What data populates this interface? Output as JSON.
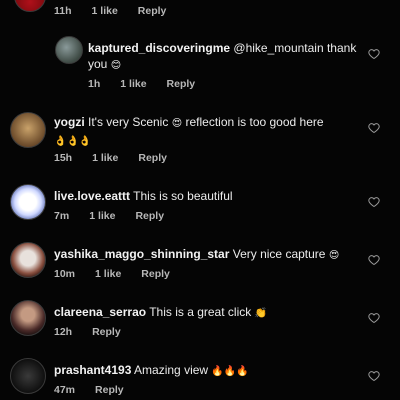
{
  "colors": {
    "background": "#050505",
    "text": "#f2f2f2",
    "meta": "#b8b8b8"
  },
  "top_meta": {
    "time": "11h",
    "likes": "1 like",
    "reply": "Reply"
  },
  "comments": [
    {
      "username": "kaptured_discoveringme",
      "text": "@hike_mountain thank you",
      "emoji": "😊",
      "time": "1h",
      "likes": "1 like",
      "reply": "Reply"
    },
    {
      "username": "yogzi",
      "text": "It's very Scenic",
      "emoji_mid": "😍",
      "text2": "reflection is too good here",
      "emoji_line2": "👌👌👌",
      "time": "15h",
      "likes": "1 like",
      "reply": "Reply"
    },
    {
      "username": "live.love.eattt",
      "text": "This is so beautiful",
      "time": "7m",
      "likes": "1 like",
      "reply": "Reply"
    },
    {
      "username": "yashika_maggo_shinning_star",
      "text": "Very nice capture",
      "emoji": "😍",
      "time": "10m",
      "likes": "1 like",
      "reply": "Reply"
    },
    {
      "username": "clareena_serrao",
      "text": "This is a great click",
      "emoji": "👏",
      "time": "12h",
      "reply": "Reply"
    },
    {
      "username": "prashant4193",
      "text": "Amazing view",
      "emoji": "🔥🔥🔥",
      "time": "47m",
      "reply": "Reply"
    }
  ]
}
